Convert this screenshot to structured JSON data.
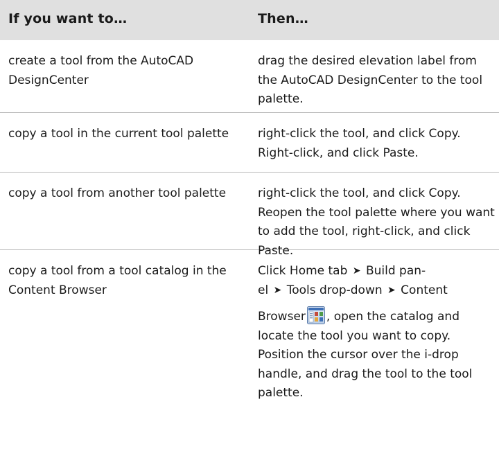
{
  "header": {
    "col1": "If you want to…",
    "col2": "Then…"
  },
  "rows": [
    {
      "col1": "create a tool from the AutoCAD DesignCenter",
      "col2": "drag the desired elevation label from the AutoCAD DesignCenter to the tool palette."
    },
    {
      "col1": "copy a tool in the current tool palette",
      "col2": "right-click the tool, and click Copy. Right-click, and click Paste."
    },
    {
      "col1": "copy a tool from another tool palette",
      "col2": "right-click the tool, and click Copy. Reopen the tool palette where you want to add the tool, right-click, and click Paste."
    },
    {
      "col1": "copy a tool from a tool catalog in the Content Browser",
      "col2": {
        "part1": "Click Home tab",
        "part2": "Build pan-",
        "part3": "el",
        "part4": "Tools drop-down",
        "part5": "Content",
        "part6": "Browser",
        "part7": ", open the catalog and locate the tool you want to copy. Position the cursor over the i-drop handle, and drag the tool to the tool palette.",
        "arrow": "➤",
        "icon": "content-browser-icon"
      }
    }
  ]
}
